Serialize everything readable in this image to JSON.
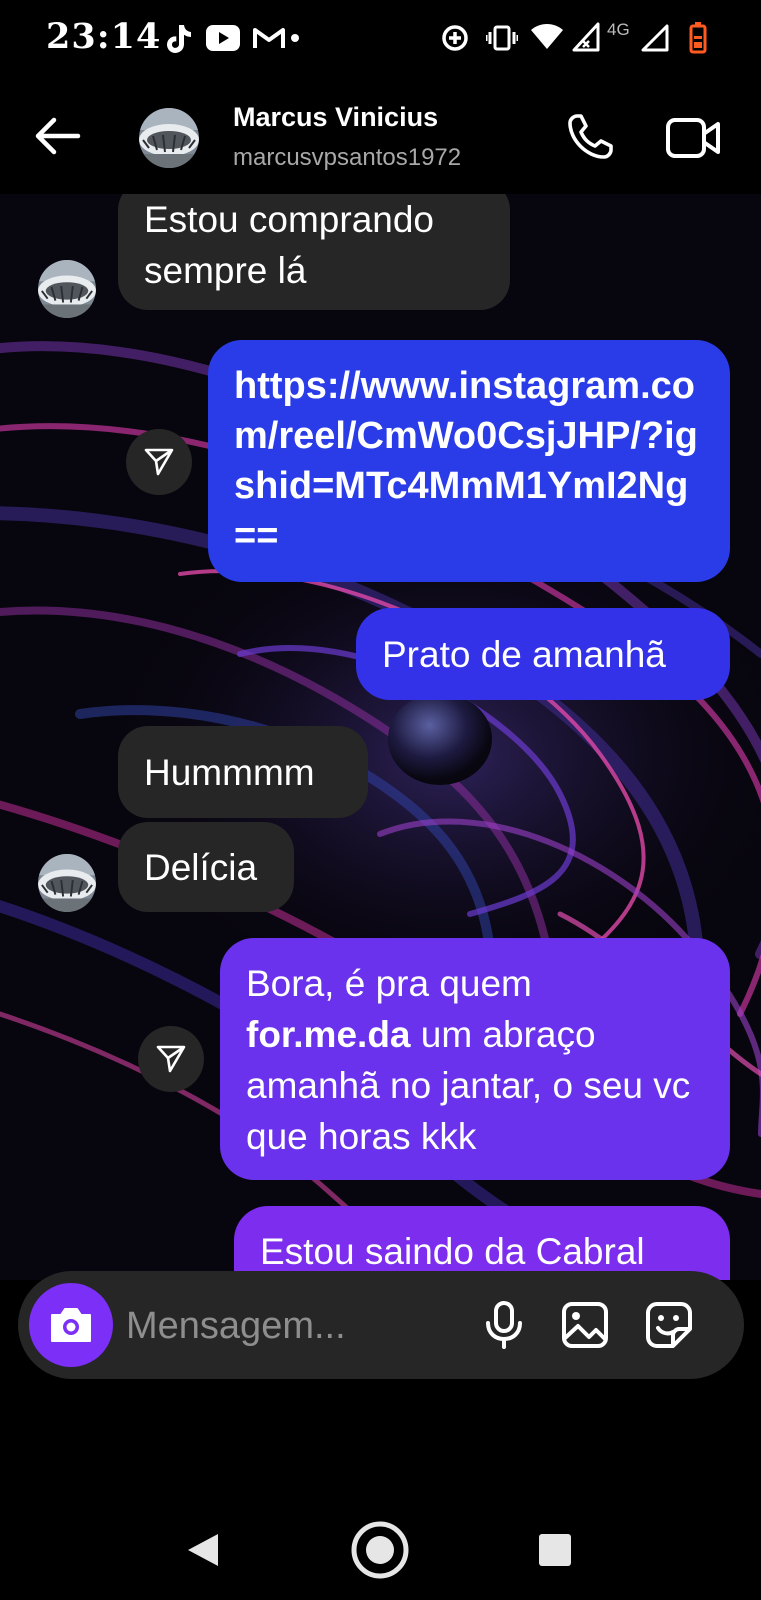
{
  "status_bar": {
    "time": "23:14",
    "network_label": "4G",
    "icons": [
      "tiktok-icon",
      "youtube-icon",
      "gmail-icon",
      "dot-icon",
      "data-saver-icon",
      "vibrate-icon",
      "wifi-icon",
      "signal-icon",
      "signal-icon",
      "battery-low-icon"
    ]
  },
  "header": {
    "name": "Marcus Vinicius",
    "username": "marcusvpsantos1972",
    "icons": [
      "back-arrow-icon",
      "phone-icon",
      "video-camera-icon"
    ]
  },
  "messages": [
    {
      "direction": "incoming",
      "text": "Estou comprando sempre lá"
    },
    {
      "direction": "outgoing",
      "type": "link",
      "text": "https://www.instagram.com/reel/CmWo0CsjJHP/?igshid=MTc4MmM1YmI2Ng=="
    },
    {
      "direction": "outgoing",
      "text": "Prato de amanhã"
    },
    {
      "direction": "incoming",
      "text": "Hummmm"
    },
    {
      "direction": "incoming",
      "text": "Delícia"
    },
    {
      "direction": "outgoing",
      "parts": [
        "Bora, é pra quem ",
        "for.me.da",
        " um abraço amanhã no jantar, o seu vc que horas kkk"
      ]
    },
    {
      "direction": "outgoing",
      "partial": true,
      "text": "Estou saindo da Cabral"
    }
  ],
  "composer": {
    "placeholder": "Mensagem...",
    "icons": [
      "camera-icon",
      "microphone-icon",
      "gallery-icon",
      "sticker-icon"
    ]
  },
  "nav": {
    "icons": [
      "back-triangle-icon",
      "home-circle-icon",
      "recents-square-icon"
    ]
  },
  "colors": {
    "incoming_bubble": "#262626",
    "outgoing_blue": "#2a3ce8",
    "outgoing_purple": "#7c2ded",
    "camera_button": "#7b2ff7",
    "battery_low": "#ff5a1f"
  }
}
